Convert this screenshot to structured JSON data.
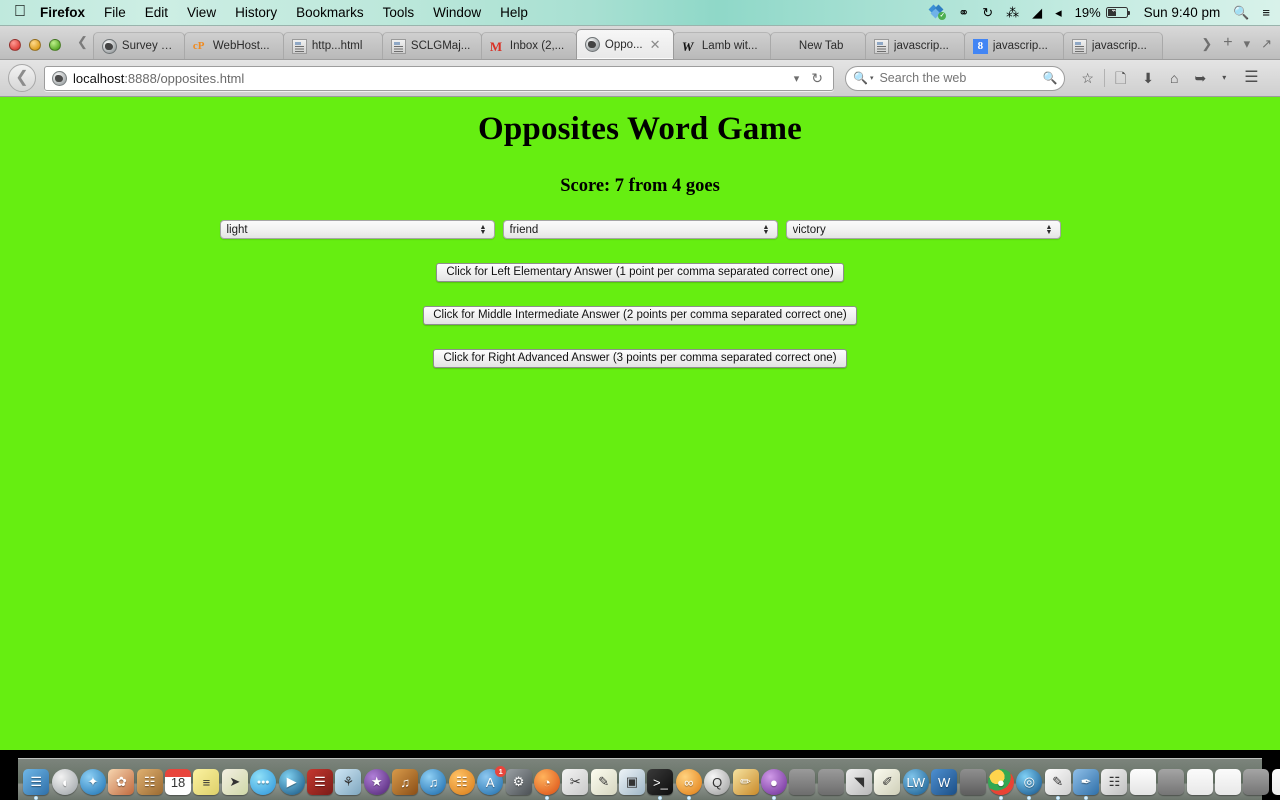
{
  "menubar": {
    "apple_icon": "apple-logo-icon",
    "items": [
      {
        "label": "Firefox",
        "bold": true
      },
      {
        "label": "File",
        "bold": false
      },
      {
        "label": "Edit",
        "bold": false
      },
      {
        "label": "View",
        "bold": false
      },
      {
        "label": "History",
        "bold": false
      },
      {
        "label": "Bookmarks",
        "bold": false
      },
      {
        "label": "Tools",
        "bold": false
      },
      {
        "label": "Window",
        "bold": false
      },
      {
        "label": "Help",
        "bold": false
      }
    ],
    "status": {
      "dropbox_icon": "dropbox-icon",
      "accessibility_icon": "accessibility-icon",
      "timemachine_icon": "time-machine-icon",
      "bluetooth_icon": "bluetooth-icon",
      "wifi_icon": "wifi-icon",
      "volume_icon": "volume-icon",
      "battery_percent": "19%",
      "battery_icon": "battery-charging-icon",
      "clock": "Sun 9:40 pm",
      "spotlight_icon": "search-icon",
      "notifications_icon": "notification-center-icon"
    }
  },
  "window": {
    "traffic_lights": [
      "close-button",
      "minimize-button",
      "zoom-button"
    ],
    "tab_scroll_left_icon": "chevron-left-icon",
    "tabs": [
      {
        "label": "Survey R...",
        "favicon": "globe-icon",
        "active": false,
        "width_class": "tab-w-survey"
      },
      {
        "label": "WebHost...",
        "favicon": "cpanel-icon",
        "active": false,
        "width_class": "tab-w-webhost"
      },
      {
        "label": "http...html",
        "favicon": "document-icon",
        "active": false,
        "width_class": "tab-w-http"
      },
      {
        "label": "SCLGMaj...",
        "favicon": "document-icon",
        "active": false,
        "width_class": "tab-w-sclg"
      },
      {
        "label": "Inbox (2,...",
        "favicon": "gmail-icon",
        "active": false,
        "width_class": "tab-w-inbox"
      },
      {
        "label": "Oppo...",
        "favicon": "globe-icon",
        "active": true,
        "close_icon": "close-icon",
        "width_class": "tab-w-active"
      },
      {
        "label": "Lamb wit...",
        "favicon": "lamb-icon",
        "active": false,
        "width_class": "tab-w-lamb"
      },
      {
        "label": "New Tab",
        "favicon": "no-icon",
        "active": false,
        "width_class": "tab-w-newtab"
      },
      {
        "label": "javascrip...",
        "favicon": "java-doc-icon",
        "active": false,
        "width_class": "tab-w-js1"
      },
      {
        "label": "javascrip...",
        "favicon": "google-icon",
        "active": false,
        "width_class": "tab-w-js2"
      },
      {
        "label": "javascrip...",
        "favicon": "java-doc-icon",
        "active": false,
        "width_class": "tab-w-js3"
      }
    ],
    "tabbar_right": {
      "scroll_right_icon": "chevron-right-icon",
      "new_tab_icon": "plus-icon",
      "list_all_tabs_icon": "chevron-down-icon",
      "fullscreen_icon": "fullscreen-icon"
    },
    "toolbar": {
      "back_icon": "back-arrow-icon",
      "url_identity_icon": "globe-icon",
      "url_host": "localhost",
      "url_rest": ":8888/opposites.html",
      "url_dropdown_icon": "chevron-down-icon",
      "reload_icon": "reload-icon",
      "search_placeholder": "Search the web",
      "search_value": "",
      "search_engine_icon": "search-icon",
      "search_submit_icon": "search-icon",
      "bookmark_icon": "star-icon",
      "reader_icon": "reader-list-icon",
      "downloads_icon": "download-arrow-icon",
      "home_icon": "home-icon",
      "pocket_icon": "pocket-icon",
      "overflow_icon": "chevron-down-icon",
      "menu_icon": "hamburger-menu-icon"
    }
  },
  "page": {
    "background_color": "#66ee11",
    "title": "Opposites Word Game",
    "score_text": "Score: 7 from 4 goes",
    "score_value": 7,
    "goes_value": 4,
    "selects": [
      {
        "name": "left-word-select",
        "value": "light",
        "stepper_icon": "stepper-up-down-icon"
      },
      {
        "name": "middle-word-select",
        "value": "friend",
        "stepper_icon": "stepper-up-down-icon"
      },
      {
        "name": "right-word-select",
        "value": "victory",
        "stepper_icon": "stepper-up-down-icon"
      }
    ],
    "buttons": [
      {
        "name": "left-elementary-answer-button",
        "label": "Click for Left Elementary Answer (1 point per comma separated correct one)"
      },
      {
        "name": "middle-intermediate-answer-button",
        "label": "Click for Middle Intermediate Answer (2 points per comma separated correct one)"
      },
      {
        "name": "right-advanced-answer-button",
        "label": "Click for Right Advanced Answer (3 points per comma separated correct one)"
      }
    ]
  },
  "dock": {
    "items": [
      {
        "name": "finder",
        "icon": "finder-icon",
        "glyph": "☰",
        "bg": "linear-gradient(135deg,#6fb7e8,#2f6fa8)",
        "running": true
      },
      {
        "name": "launchpad",
        "icon": "launchpad-icon",
        "glyph": "◖",
        "bg": "radial-gradient(circle at 35% 30%,#f2f2f2,#9aa0a4)",
        "round": true,
        "running": false
      },
      {
        "name": "safari",
        "icon": "safari-compass-icon",
        "glyph": "✦",
        "bg": "radial-gradient(circle at 35% 30%,#8ed0f5,#1a6fb0)",
        "round": true,
        "running": false
      },
      {
        "name": "photos",
        "icon": "photos-icon",
        "glyph": "✿",
        "bg": "linear-gradient(135deg,#f7d6b0,#c06a3f)",
        "running": false
      },
      {
        "name": "contacts",
        "icon": "contacts-book-icon",
        "glyph": "☷",
        "bg": "linear-gradient(135deg,#e0b070,#9a6a31)",
        "running": false
      },
      {
        "name": "calendar",
        "icon": "calendar-icon",
        "glyph": "18",
        "bg": "linear-gradient(to bottom,#e8453c 0 30%,#ffffff 30% 100%)",
        "dark": true,
        "running": false
      },
      {
        "name": "notes",
        "icon": "notes-icon",
        "glyph": "≡",
        "bg": "linear-gradient(135deg,#fbf2a0,#ded06a)",
        "dark": true,
        "running": false
      },
      {
        "name": "maps",
        "icon": "maps-icon",
        "glyph": "➤",
        "bg": "linear-gradient(135deg,#f3efe2,#cfd8a8)",
        "dark": true,
        "running": false
      },
      {
        "name": "messages",
        "icon": "messages-bubble-icon",
        "glyph": "●●●",
        "bg": "radial-gradient(circle at 35% 30%,#8fe0f8,#2b93d8)",
        "round": true,
        "running": false
      },
      {
        "name": "facetime",
        "icon": "facetime-camera-icon",
        "glyph": "▶",
        "bg": "radial-gradient(circle at 35% 30%,#7fd0f0,#14517e)",
        "round": true,
        "running": false
      },
      {
        "name": "photo-booth",
        "icon": "photo-booth-icon",
        "glyph": "☰",
        "bg": "linear-gradient(135deg,#c6372f,#7a1c17)",
        "running": false
      },
      {
        "name": "iphoto",
        "icon": "iphoto-icon",
        "glyph": "⚘",
        "bg": "linear-gradient(135deg,#cfe6f5,#7fa7bf)",
        "dark": true,
        "running": false
      },
      {
        "name": "imovie",
        "icon": "imovie-star-icon",
        "glyph": "★",
        "bg": "radial-gradient(circle at 35% 30%,#b07fd8,#4c2170)",
        "round": true,
        "running": false
      },
      {
        "name": "garageband",
        "icon": "garageband-guitar-icon",
        "glyph": "♫",
        "bg": "linear-gradient(135deg,#d89a4a,#8a4e16)",
        "running": false
      },
      {
        "name": "itunes",
        "icon": "itunes-note-icon",
        "glyph": "♫",
        "bg": "radial-gradient(circle at 35% 30%,#8fd0f5,#1565a8)",
        "round": true,
        "running": false
      },
      {
        "name": "ibooks",
        "icon": "ibooks-icon",
        "glyph": "☷",
        "bg": "radial-gradient(circle at 35% 30%,#ffc266,#d87a16)",
        "round": true,
        "running": false
      },
      {
        "name": "app-store",
        "icon": "app-store-icon",
        "glyph": "A",
        "bg": "radial-gradient(circle at 35% 30%,#8ec8f0,#1b6aa8)",
        "round": true,
        "badge": "1",
        "running": false
      },
      {
        "name": "system-preferences",
        "icon": "system-preferences-gear-icon",
        "glyph": "⚙",
        "bg": "linear-gradient(135deg,#9aa0a4,#4b5054)",
        "running": false
      },
      {
        "name": "firefox",
        "icon": "firefox-icon",
        "glyph": "◔",
        "bg": "radial-gradient(circle at 35% 30%,#ffb35c,#d94b12)",
        "round": true,
        "running": true
      },
      {
        "name": "scissors-app",
        "icon": "scissors-icon",
        "glyph": "✂",
        "bg": "linear-gradient(135deg,#f4f4f4,#c9c9c9)",
        "dark": true,
        "running": false
      },
      {
        "name": "textedit",
        "icon": "textedit-icon",
        "glyph": "✎",
        "bg": "linear-gradient(135deg,#fdfdf0,#d6d6c0)",
        "dark": true,
        "running": false
      },
      {
        "name": "preview",
        "icon": "preview-image-icon",
        "glyph": "▣",
        "bg": "linear-gradient(135deg,#eef4f8,#9fb6c6)",
        "dark": true,
        "running": false
      },
      {
        "name": "terminal",
        "icon": "terminal-icon",
        "glyph": ">_",
        "bg": "linear-gradient(135deg,#3a3a3a,#0d0d0d)",
        "running": true
      },
      {
        "name": "processing",
        "icon": "processing-app-icon",
        "glyph": "∞",
        "bg": "radial-gradient(circle at 35% 30%,#ffd27f,#e07a10)",
        "round": true,
        "running": true
      },
      {
        "name": "grapher",
        "icon": "grapher-sphere-icon",
        "glyph": "Q",
        "bg": "radial-gradient(circle at 35% 30%,#f7f7f7,#9a9a9a)",
        "round": true,
        "dark": true,
        "running": false
      },
      {
        "name": "paintbrush-app",
        "icon": "paintbrush-icon",
        "glyph": "✏",
        "bg": "linear-gradient(135deg,#f6e3a0,#c98a2a)",
        "running": false
      },
      {
        "name": "purple-sphere-app",
        "icon": "sphere-icon",
        "glyph": "●",
        "bg": "radial-gradient(circle at 35% 30%,#d09ae8,#6a2b94)",
        "round": true,
        "running": true
      },
      {
        "name": "window-thumb-1",
        "icon": "minimized-window-icon",
        "glyph": "",
        "bg": "linear-gradient(to bottom,#9a9a9a,#6d6d6d)",
        "running": false
      },
      {
        "name": "window-thumb-2",
        "icon": "minimized-window-icon",
        "glyph": "",
        "bg": "linear-gradient(to bottom,#9a9a9a,#6d6d6d)",
        "running": false
      },
      {
        "name": "stickies",
        "icon": "stickies-icon",
        "glyph": "◥",
        "bg": "linear-gradient(135deg,#f0f0f0,#b8b8b8)",
        "dark": true,
        "running": false
      },
      {
        "name": "drawing-app",
        "icon": "drawing-compass-icon",
        "glyph": "✐",
        "bg": "linear-gradient(135deg,#fbfbf0,#cfcfb8)",
        "dark": true,
        "running": false
      },
      {
        "name": "lw-app",
        "icon": "lw-app-icon",
        "glyph": "LW",
        "bg": "radial-gradient(circle at 35% 30%,#7fc4ea,#15588c)",
        "round": true,
        "running": false
      },
      {
        "name": "word",
        "icon": "microsoft-word-icon",
        "glyph": "W",
        "bg": "linear-gradient(135deg,#4e8fd0,#1b4f86)",
        "running": false
      },
      {
        "name": "window-thumb-3",
        "icon": "minimized-window-icon",
        "glyph": "",
        "bg": "linear-gradient(to bottom,#8f8f8f,#5e5e5e)",
        "running": false
      },
      {
        "name": "chrome",
        "icon": "google-chrome-icon",
        "glyph": "●",
        "bg": "radial-gradient(circle at 35% 30%,#ffd34d 0 30%,#34a853 30% 55%,#ea4335 55% 100%)",
        "round": true,
        "running": true
      },
      {
        "name": "blue-sphere-app",
        "icon": "sphere-icon",
        "glyph": "◎",
        "bg": "radial-gradient(circle at 35% 30%,#7fd0f5,#114e86)",
        "round": true,
        "running": true
      },
      {
        "name": "documents-stack",
        "icon": "documents-icon",
        "glyph": "✎",
        "bg": "linear-gradient(135deg,#fcfcfc,#cfcfcf)",
        "dark": true,
        "running": true
      },
      {
        "name": "folder-blue",
        "icon": "folder-icon",
        "glyph": "✒",
        "bg": "linear-gradient(135deg,#8fbfe8,#2f6fa8)",
        "running": true
      },
      {
        "name": "book-app",
        "icon": "book-icon",
        "glyph": "☷",
        "bg": "linear-gradient(135deg,#f4f4f4,#c0c0c0)",
        "dark": true,
        "running": false
      },
      {
        "name": "document-window",
        "icon": "document-window-icon",
        "glyph": "",
        "bg": "linear-gradient(to bottom,#fdfdfd,#e4e4e4)",
        "running": false
      },
      {
        "name": "minimized-window-4",
        "icon": "minimized-window-icon",
        "glyph": "",
        "bg": "linear-gradient(to bottom,#a4a4a4,#757575)",
        "running": false
      },
      {
        "name": "minimized-window-5",
        "icon": "minimized-window-icon",
        "glyph": "",
        "bg": "linear-gradient(to bottom,#fbfbfb,#e8e8e8)",
        "running": false
      },
      {
        "name": "minimized-window-6",
        "icon": "minimized-window-icon",
        "glyph": "",
        "bg": "linear-gradient(to bottom,#fbfbfb,#e8e8e8)",
        "running": false
      },
      {
        "name": "minimized-window-7",
        "icon": "minimized-window-icon",
        "glyph": "",
        "bg": "linear-gradient(to bottom,#a4a4a4,#757575)",
        "running": false
      },
      {
        "name": "minimized-window-8",
        "icon": "minimized-window-icon",
        "glyph": "",
        "bg": "linear-gradient(to bottom,#fbfbfb,#ececec)",
        "running": false
      },
      {
        "name": "minimized-window-9",
        "icon": "minimized-window-icon",
        "glyph": "",
        "bg": "linear-gradient(to bottom,#fdfdfd,#efefef)",
        "running": false
      },
      {
        "name": "minimized-window-10",
        "icon": "minimized-window-icon",
        "glyph": "",
        "bg": "linear-gradient(to bottom,#fdfdfd,#e8e8e8)",
        "running": false
      }
    ],
    "trash": {
      "name": "trash",
      "icon": "trash-icon"
    }
  }
}
